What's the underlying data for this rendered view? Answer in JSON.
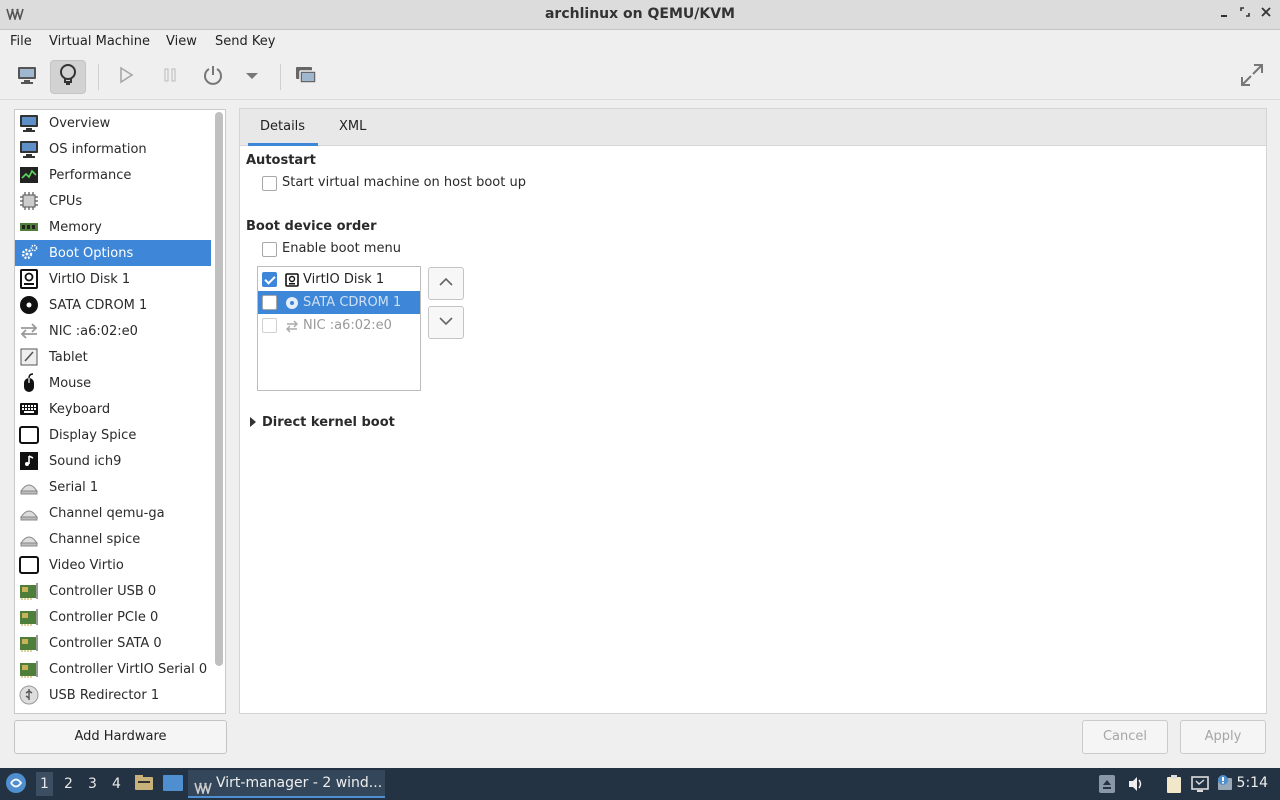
{
  "window": {
    "title": "archlinux on QEMU/KVM",
    "minimize_glyph": "▪",
    "maximize_glyph": "‹›",
    "close_glyph": "✕"
  },
  "menubar": {
    "items": [
      "File",
      "Virtual Machine",
      "View",
      "Send Key"
    ]
  },
  "toolbar": {
    "buttons": [
      {
        "name": "console-view-icon",
        "active": false
      },
      {
        "name": "details-view-lightbulb-icon",
        "active": true
      },
      {
        "name": "run-icon",
        "active": false
      },
      {
        "name": "pause-icon",
        "active": false
      },
      {
        "name": "power-icon",
        "active": false
      },
      {
        "name": "power-menu-dropdown-icon",
        "active": false
      },
      {
        "name": "snapshots-icon",
        "active": false
      },
      {
        "name": "fullscreen-icon",
        "active": false
      }
    ]
  },
  "sidebar": {
    "items": [
      {
        "label": "Overview",
        "icon": "monitor-icon"
      },
      {
        "label": "OS information",
        "icon": "monitor-icon"
      },
      {
        "label": "Performance",
        "icon": "performance-graph-icon"
      },
      {
        "label": "CPUs",
        "icon": "cpu-chip-icon"
      },
      {
        "label": "Memory",
        "icon": "memory-module-icon"
      },
      {
        "label": "Boot Options",
        "icon": "gear-icon",
        "selected": true
      },
      {
        "label": "VirtIO Disk 1",
        "icon": "disk-icon"
      },
      {
        "label": "SATA CDROM 1",
        "icon": "cdrom-icon"
      },
      {
        "label": "NIC :a6:02:e0",
        "icon": "network-arrows-icon"
      },
      {
        "label": "Tablet",
        "icon": "tablet-icon"
      },
      {
        "label": "Mouse",
        "icon": "mouse-icon"
      },
      {
        "label": "Keyboard",
        "icon": "keyboard-icon"
      },
      {
        "label": "Display Spice",
        "icon": "display-icon"
      },
      {
        "label": "Sound ich9",
        "icon": "sound-icon"
      },
      {
        "label": "Serial 1",
        "icon": "serial-icon"
      },
      {
        "label": "Channel qemu-ga",
        "icon": "channel-icon"
      },
      {
        "label": "Channel spice",
        "icon": "channel-icon"
      },
      {
        "label": "Video Virtio",
        "icon": "video-icon"
      },
      {
        "label": "Controller USB 0",
        "icon": "controller-card-icon"
      },
      {
        "label": "Controller PCIe 0",
        "icon": "controller-card-icon"
      },
      {
        "label": "Controller SATA 0",
        "icon": "controller-card-icon"
      },
      {
        "label": "Controller VirtIO Serial 0",
        "icon": "controller-card-icon"
      },
      {
        "label": "USB Redirector 1",
        "icon": "usb-icon"
      }
    ],
    "add_hardware_label": "Add Hardware"
  },
  "tabs": {
    "details": "Details",
    "xml": "XML",
    "active": "Details"
  },
  "autostart": {
    "title": "Autostart",
    "checkbox_label": "Start virtual machine on host boot up",
    "checked": false
  },
  "boot": {
    "title": "Boot device order",
    "enable_menu_label": "Enable boot menu",
    "enable_menu_checked": false,
    "devices": [
      {
        "label": "VirtIO Disk 1",
        "checked": true,
        "selected": false,
        "icon": "disk-icon"
      },
      {
        "label": "SATA CDROM 1",
        "checked": false,
        "selected": true,
        "icon": "cdrom-icon"
      },
      {
        "label": "NIC :a6:02:e0",
        "checked": false,
        "selected": false,
        "icon": "network-arrows-icon"
      }
    ]
  },
  "direct_kernel": {
    "label": "Direct kernel boot"
  },
  "actions": {
    "cancel": "Cancel",
    "apply": "Apply"
  },
  "taskbar": {
    "workspaces": [
      "1",
      "2",
      "3",
      "4"
    ],
    "current_workspace": "1",
    "task_label": "Virt-manager - 2 wind...",
    "clock": "5:14"
  },
  "colors": {
    "accent": "#3d86d8",
    "taskbar": "#243343"
  }
}
